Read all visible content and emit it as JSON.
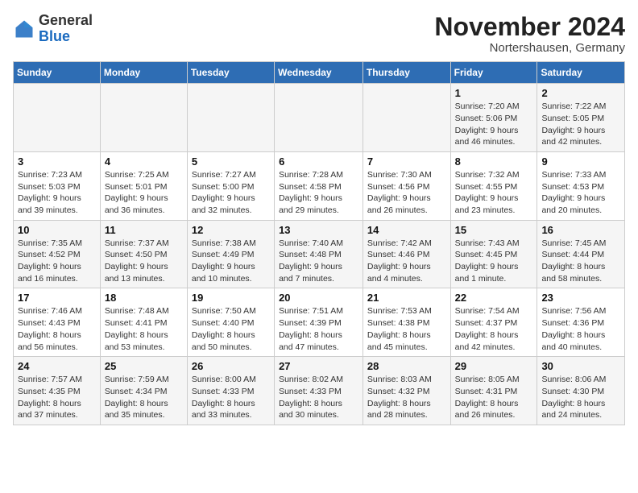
{
  "header": {
    "logo_general": "General",
    "logo_blue": "Blue",
    "month_title": "November 2024",
    "location": "Nortershausen, Germany"
  },
  "days_of_week": [
    "Sunday",
    "Monday",
    "Tuesday",
    "Wednesday",
    "Thursday",
    "Friday",
    "Saturday"
  ],
  "weeks": [
    [
      {
        "num": "",
        "info": ""
      },
      {
        "num": "",
        "info": ""
      },
      {
        "num": "",
        "info": ""
      },
      {
        "num": "",
        "info": ""
      },
      {
        "num": "",
        "info": ""
      },
      {
        "num": "1",
        "info": "Sunrise: 7:20 AM\nSunset: 5:06 PM\nDaylight: 9 hours and 46 minutes."
      },
      {
        "num": "2",
        "info": "Sunrise: 7:22 AM\nSunset: 5:05 PM\nDaylight: 9 hours and 42 minutes."
      }
    ],
    [
      {
        "num": "3",
        "info": "Sunrise: 7:23 AM\nSunset: 5:03 PM\nDaylight: 9 hours and 39 minutes."
      },
      {
        "num": "4",
        "info": "Sunrise: 7:25 AM\nSunset: 5:01 PM\nDaylight: 9 hours and 36 minutes."
      },
      {
        "num": "5",
        "info": "Sunrise: 7:27 AM\nSunset: 5:00 PM\nDaylight: 9 hours and 32 minutes."
      },
      {
        "num": "6",
        "info": "Sunrise: 7:28 AM\nSunset: 4:58 PM\nDaylight: 9 hours and 29 minutes."
      },
      {
        "num": "7",
        "info": "Sunrise: 7:30 AM\nSunset: 4:56 PM\nDaylight: 9 hours and 26 minutes."
      },
      {
        "num": "8",
        "info": "Sunrise: 7:32 AM\nSunset: 4:55 PM\nDaylight: 9 hours and 23 minutes."
      },
      {
        "num": "9",
        "info": "Sunrise: 7:33 AM\nSunset: 4:53 PM\nDaylight: 9 hours and 20 minutes."
      }
    ],
    [
      {
        "num": "10",
        "info": "Sunrise: 7:35 AM\nSunset: 4:52 PM\nDaylight: 9 hours and 16 minutes."
      },
      {
        "num": "11",
        "info": "Sunrise: 7:37 AM\nSunset: 4:50 PM\nDaylight: 9 hours and 13 minutes."
      },
      {
        "num": "12",
        "info": "Sunrise: 7:38 AM\nSunset: 4:49 PM\nDaylight: 9 hours and 10 minutes."
      },
      {
        "num": "13",
        "info": "Sunrise: 7:40 AM\nSunset: 4:48 PM\nDaylight: 9 hours and 7 minutes."
      },
      {
        "num": "14",
        "info": "Sunrise: 7:42 AM\nSunset: 4:46 PM\nDaylight: 9 hours and 4 minutes."
      },
      {
        "num": "15",
        "info": "Sunrise: 7:43 AM\nSunset: 4:45 PM\nDaylight: 9 hours and 1 minute."
      },
      {
        "num": "16",
        "info": "Sunrise: 7:45 AM\nSunset: 4:44 PM\nDaylight: 8 hours and 58 minutes."
      }
    ],
    [
      {
        "num": "17",
        "info": "Sunrise: 7:46 AM\nSunset: 4:43 PM\nDaylight: 8 hours and 56 minutes."
      },
      {
        "num": "18",
        "info": "Sunrise: 7:48 AM\nSunset: 4:41 PM\nDaylight: 8 hours and 53 minutes."
      },
      {
        "num": "19",
        "info": "Sunrise: 7:50 AM\nSunset: 4:40 PM\nDaylight: 8 hours and 50 minutes."
      },
      {
        "num": "20",
        "info": "Sunrise: 7:51 AM\nSunset: 4:39 PM\nDaylight: 8 hours and 47 minutes."
      },
      {
        "num": "21",
        "info": "Sunrise: 7:53 AM\nSunset: 4:38 PM\nDaylight: 8 hours and 45 minutes."
      },
      {
        "num": "22",
        "info": "Sunrise: 7:54 AM\nSunset: 4:37 PM\nDaylight: 8 hours and 42 minutes."
      },
      {
        "num": "23",
        "info": "Sunrise: 7:56 AM\nSunset: 4:36 PM\nDaylight: 8 hours and 40 minutes."
      }
    ],
    [
      {
        "num": "24",
        "info": "Sunrise: 7:57 AM\nSunset: 4:35 PM\nDaylight: 8 hours and 37 minutes."
      },
      {
        "num": "25",
        "info": "Sunrise: 7:59 AM\nSunset: 4:34 PM\nDaylight: 8 hours and 35 minutes."
      },
      {
        "num": "26",
        "info": "Sunrise: 8:00 AM\nSunset: 4:33 PM\nDaylight: 8 hours and 33 minutes."
      },
      {
        "num": "27",
        "info": "Sunrise: 8:02 AM\nSunset: 4:33 PM\nDaylight: 8 hours and 30 minutes."
      },
      {
        "num": "28",
        "info": "Sunrise: 8:03 AM\nSunset: 4:32 PM\nDaylight: 8 hours and 28 minutes."
      },
      {
        "num": "29",
        "info": "Sunrise: 8:05 AM\nSunset: 4:31 PM\nDaylight: 8 hours and 26 minutes."
      },
      {
        "num": "30",
        "info": "Sunrise: 8:06 AM\nSunset: 4:30 PM\nDaylight: 8 hours and 24 minutes."
      }
    ]
  ]
}
